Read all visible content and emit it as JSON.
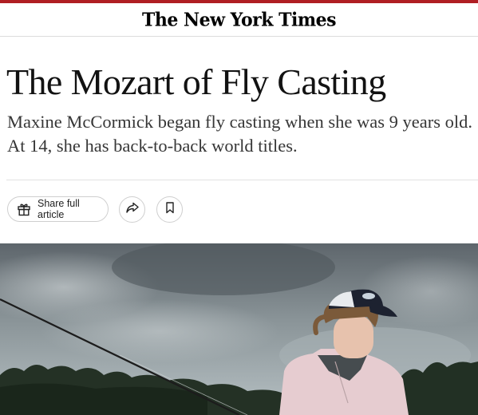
{
  "masthead": {
    "logo_text": "The New York Times"
  },
  "article": {
    "headline": "The Mozart of Fly Casting",
    "summary": "Maxine McCormick began fly casting when she was 9 years old. At 14, she has back-to-back world titles."
  },
  "actions": {
    "share_label": "Share full article"
  },
  "photo": {
    "subject": "girl-with-fly-rod"
  },
  "colors": {
    "accent_bar": "#b01e23",
    "text": "#121212",
    "summary_text": "#363636",
    "border": "#cfcfcf"
  }
}
